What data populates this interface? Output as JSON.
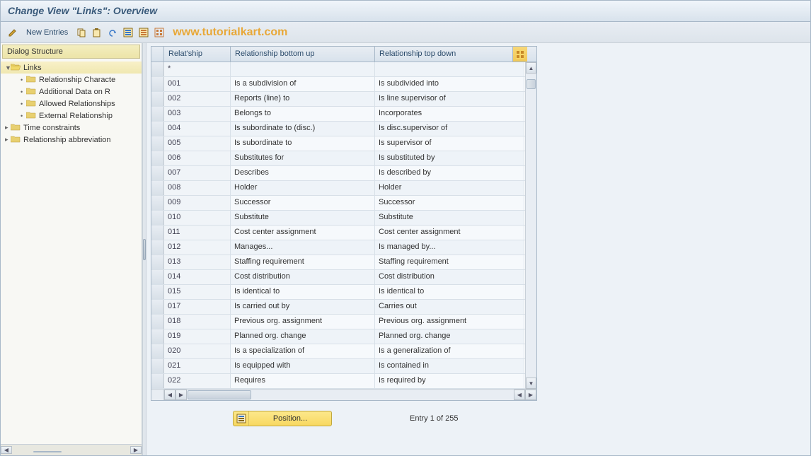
{
  "title": "Change View \"Links\": Overview",
  "toolbar": {
    "new_entries": "New Entries"
  },
  "watermark": "www.tutorialkart.com",
  "sidebar": {
    "header": "Dialog Structure",
    "items": [
      {
        "label": "Links",
        "level": 0,
        "expanded": true,
        "selected": true,
        "open": true
      },
      {
        "label": "Relationship Characte",
        "level": 1,
        "open": false
      },
      {
        "label": "Additional Data on R",
        "level": 1,
        "open": false
      },
      {
        "label": "Allowed Relationships",
        "level": 1,
        "open": false
      },
      {
        "label": "External Relationship",
        "level": 1,
        "open": false
      },
      {
        "label": "Time constraints",
        "level": 0,
        "open": false
      },
      {
        "label": "Relationship abbreviation",
        "level": 0,
        "open": false
      }
    ]
  },
  "table": {
    "columns": {
      "rel": "Relat'ship",
      "bottom_up": "Relationship bottom up",
      "top_down": "Relationship top down"
    },
    "rows": [
      {
        "rel": "*",
        "bu": "",
        "td": ""
      },
      {
        "rel": "001",
        "bu": "Is a subdivision of",
        "td": "Is subdivided into"
      },
      {
        "rel": "002",
        "bu": "Reports (line) to",
        "td": "Is line supervisor of"
      },
      {
        "rel": "003",
        "bu": "Belongs to",
        "td": "Incorporates"
      },
      {
        "rel": "004",
        "bu": "Is subordinate to (disc.)",
        "td": "Is disc.supervisor of"
      },
      {
        "rel": "005",
        "bu": "Is subordinate to",
        "td": "Is supervisor of"
      },
      {
        "rel": "006",
        "bu": "Substitutes for",
        "td": "Is substituted by"
      },
      {
        "rel": "007",
        "bu": "Describes",
        "td": "Is described by"
      },
      {
        "rel": "008",
        "bu": "Holder",
        "td": "Holder"
      },
      {
        "rel": "009",
        "bu": "Successor",
        "td": "Successor"
      },
      {
        "rel": "010",
        "bu": "Substitute",
        "td": "Substitute"
      },
      {
        "rel": "011",
        "bu": "Cost center assignment",
        "td": "Cost center assignment"
      },
      {
        "rel": "012",
        "bu": "Manages...",
        "td": "Is managed by..."
      },
      {
        "rel": "013",
        "bu": "Staffing requirement",
        "td": "Staffing requirement"
      },
      {
        "rel": "014",
        "bu": "Cost distribution",
        "td": "Cost distribution"
      },
      {
        "rel": "015",
        "bu": "Is identical to",
        "td": "Is identical to"
      },
      {
        "rel": "017",
        "bu": "Is carried out by",
        "td": "Carries out"
      },
      {
        "rel": "018",
        "bu": "Previous org. assignment",
        "td": "Previous org. assignment"
      },
      {
        "rel": "019",
        "bu": "Planned org. change",
        "td": "Planned org. change"
      },
      {
        "rel": "020",
        "bu": "Is a specialization of",
        "td": "Is a generalization of"
      },
      {
        "rel": "021",
        "bu": "Is equipped with",
        "td": "Is contained in"
      },
      {
        "rel": "022",
        "bu": "Requires",
        "td": "Is required by"
      }
    ]
  },
  "footer": {
    "position_label": "Position...",
    "entry_text": "Entry 1 of 255"
  }
}
